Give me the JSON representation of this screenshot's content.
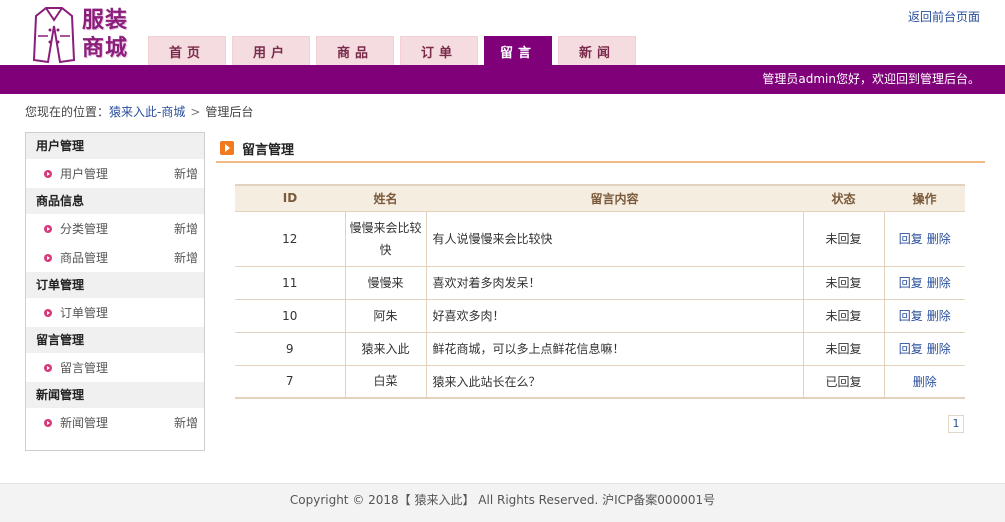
{
  "logo": {
    "text_line1": "服装",
    "text_line2": "商城"
  },
  "header": {
    "back_link": "返回前台页面",
    "tabs": [
      {
        "label": "首页"
      },
      {
        "label": "用户"
      },
      {
        "label": "商品"
      },
      {
        "label": "订单"
      },
      {
        "label": "留言"
      },
      {
        "label": "新闻"
      }
    ],
    "active_tab": "留言",
    "welcome": "管理员admin您好，欢迎回到管理后台。"
  },
  "breadcrumb": {
    "prefix": "您现在的位置：",
    "home": "猿来入此-商城",
    "separator": ">",
    "current": "管理后台"
  },
  "sidebar": {
    "groups": [
      {
        "title": "用户管理",
        "items": [
          {
            "label": "用户管理",
            "add": "新增"
          }
        ]
      },
      {
        "title": "商品信息",
        "items": [
          {
            "label": "分类管理",
            "add": "新增"
          },
          {
            "label": "商品管理",
            "add": "新增"
          }
        ]
      },
      {
        "title": "订单管理",
        "items": [
          {
            "label": "订单管理",
            "add": ""
          }
        ]
      },
      {
        "title": "留言管理",
        "items": [
          {
            "label": "留言管理",
            "add": ""
          }
        ]
      },
      {
        "title": "新闻管理",
        "items": [
          {
            "label": "新闻管理",
            "add": "新增"
          }
        ]
      }
    ]
  },
  "main": {
    "title": "留言管理",
    "table": {
      "columns": [
        "ID",
        "姓名",
        "留言内容",
        "状态",
        "操作"
      ],
      "rows": [
        {
          "id": "12",
          "name": "慢慢来会比较快",
          "content": "有人说慢慢来会比较快",
          "status": "未回复",
          "reply": "回复",
          "delete": "删除"
        },
        {
          "id": "11",
          "name": "慢慢来",
          "content": "喜欢对着多肉发呆！",
          "status": "未回复",
          "reply": "回复",
          "delete": "删除"
        },
        {
          "id": "10",
          "name": "阿朱",
          "content": "好喜欢多肉！",
          "status": "未回复",
          "reply": "回复",
          "delete": "删除"
        },
        {
          "id": "9",
          "name": "猿来入此",
          "content": "鲜花商城，可以多上点鲜花信息嘛！",
          "status": "未回复",
          "reply": "回复",
          "delete": "删除"
        },
        {
          "id": "7",
          "name": "白菜",
          "content": "猿来入此站长在么？",
          "status": "已回复",
          "reply": "",
          "delete": "删除"
        }
      ]
    },
    "pager": {
      "current": "1"
    }
  },
  "footer": {
    "text": "Copyright © 2018【 猿来入此】 All Rights Reserved. 沪ICP备案000001号"
  },
  "colors": {
    "brand_purple": "#80007a",
    "tab_inactive": "#f5dce0",
    "accent_orange": "#f07a20",
    "link_blue": "#2a4f9c"
  }
}
